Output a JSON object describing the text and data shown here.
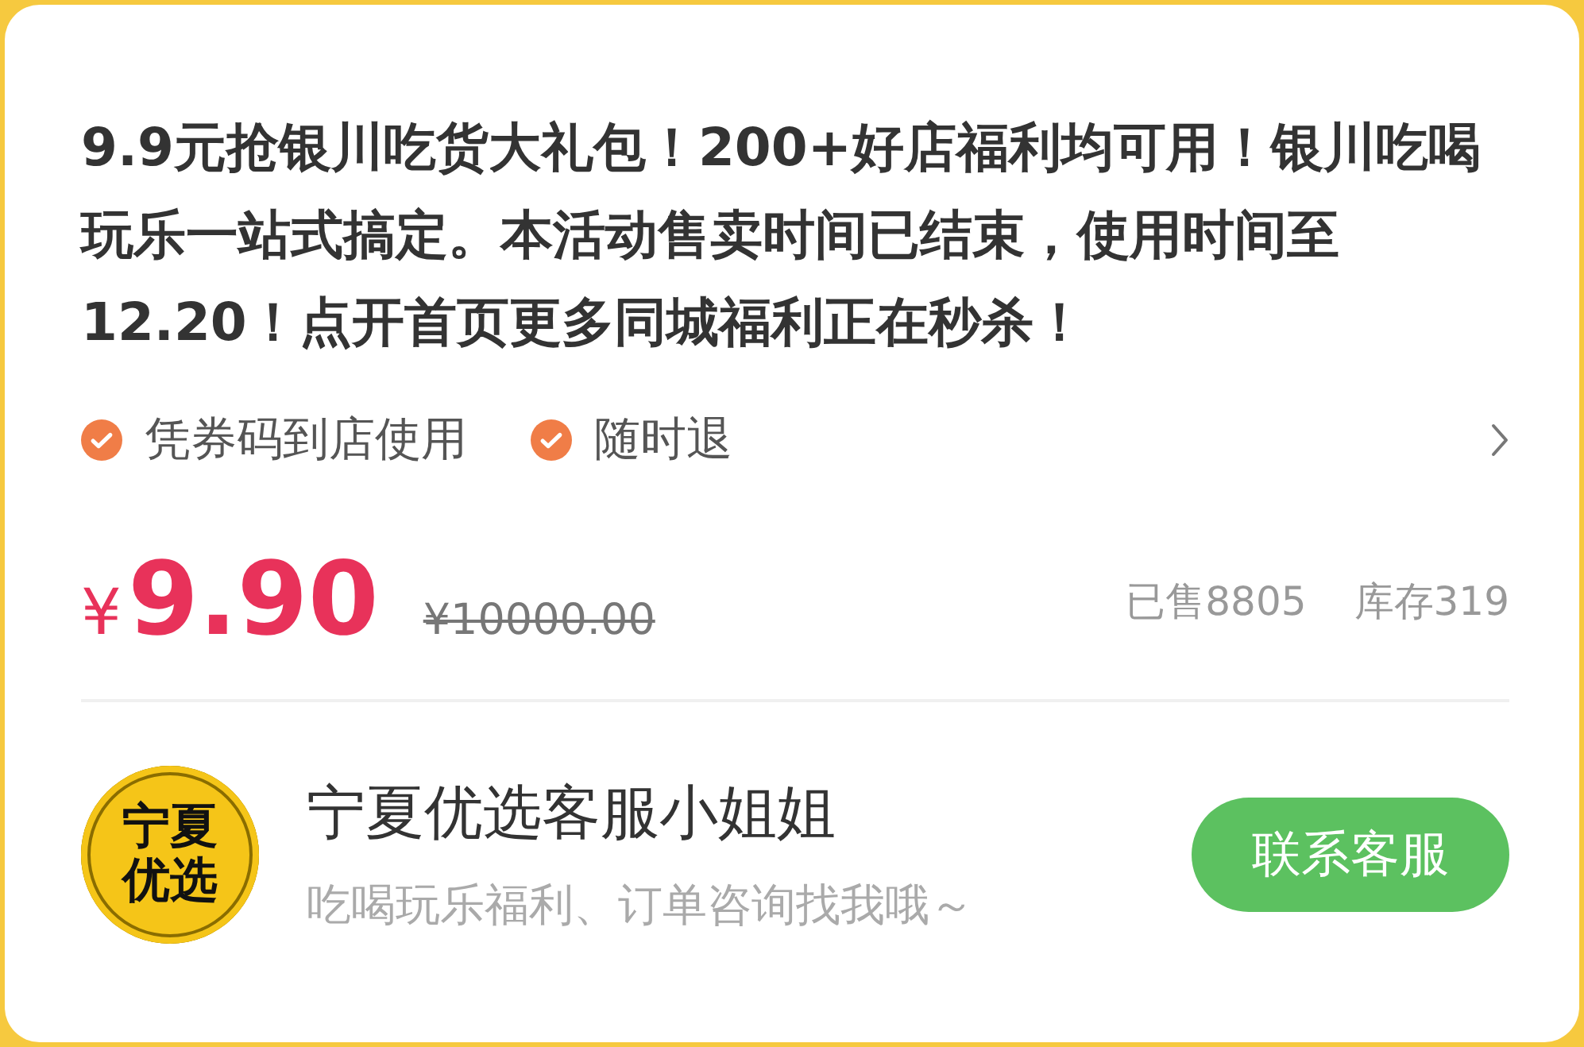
{
  "product": {
    "title": "9.9元抢银川吃货大礼包！200+好店福利均可用！银川吃喝玩乐一站式搞定。本活动售卖时间已结束，使用时间至12.20！点开首页更多同城福利正在秒杀！",
    "features": [
      {
        "label": "凭券码到店使用",
        "checked": true
      },
      {
        "label": "随时退",
        "checked": true
      }
    ],
    "currency": "¥",
    "price": "9.90",
    "original_price": "¥10000.00",
    "sold": "已售8805",
    "stock": "库存319"
  },
  "service": {
    "logo_text": "宁夏优选",
    "name": "宁夏优选客服小姐姐",
    "subtitle": "吃喝玩乐福利、订单咨询找我哦～",
    "button": "联系客服"
  }
}
